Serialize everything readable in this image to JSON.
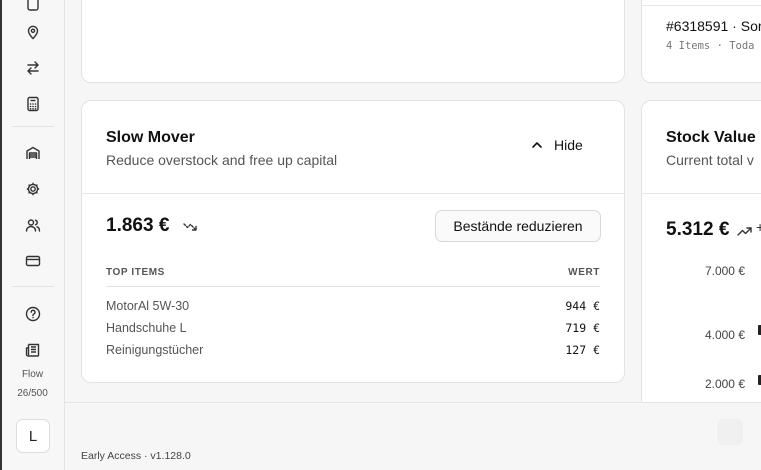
{
  "sidebar": {
    "items": [
      {
        "icon": "box-icon"
      },
      {
        "icon": "map-pin-icon"
      },
      {
        "icon": "arrows-transfer-icon"
      },
      {
        "icon": "calculator-icon"
      },
      {
        "icon": "warehouse-icon"
      },
      {
        "icon": "gear-icon"
      },
      {
        "icon": "users-icon"
      },
      {
        "icon": "credit-card-icon"
      },
      {
        "icon": "help-circle-icon"
      },
      {
        "icon": "newspaper-icon"
      }
    ],
    "flow_label": "Flow",
    "flow_count": "26/500",
    "avatar_initial": "L"
  },
  "top_right_card": {
    "order_title": "#6318591 · Sor",
    "order_meta": "4 Items · Toda"
  },
  "slow_mover": {
    "title": "Slow Mover",
    "subtitle": "Reduce overstock and free up capital",
    "hide_label": "Hide",
    "amount": "1.863 €",
    "reduce_button": "Bestände reduzieren",
    "col_left": "TOP ITEMS",
    "col_right": "WERT",
    "rows": [
      {
        "name": "MotorAl 5W-30",
        "value": "944 €"
      },
      {
        "name": "Handschuhe L",
        "value": "719 €"
      },
      {
        "name": "Reinigungstücher",
        "value": "127 €"
      }
    ]
  },
  "stock_value": {
    "title": "Stock Value",
    "subtitle": "Current total v",
    "amount": "5.312 €",
    "trend_suffix": "+",
    "y_ticks": [
      "7.000 €",
      "4.000 €",
      "2.000 €"
    ]
  },
  "footer": {
    "version": "Early Access · v1.128.0"
  },
  "colors": {
    "background": "#f6f6f6",
    "card": "#ffffff",
    "border": "#e3e3e3",
    "text": "#111111",
    "muted": "#555555"
  }
}
